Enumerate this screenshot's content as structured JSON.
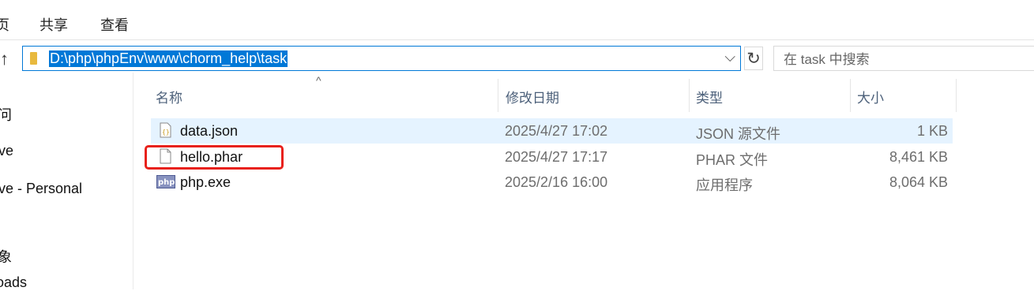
{
  "ribbon": {
    "tabs": [
      "页",
      "共享",
      "查看"
    ]
  },
  "address": {
    "path": "D:\\php\\phpEnv\\www\\chorm_help\\task"
  },
  "search": {
    "placeholder": "在 task 中搜索"
  },
  "nav": {
    "items": [
      "问",
      "ve",
      "ve - Personal",
      "象",
      "oads"
    ]
  },
  "columns": {
    "name": "名称",
    "date": "修改日期",
    "type": "类型",
    "size": "大小"
  },
  "files": [
    {
      "name": "data.json",
      "date": "2025/4/27 17:02",
      "type": "JSON 源文件",
      "size": "1 KB",
      "icon": "json-file-icon",
      "selected": true
    },
    {
      "name": "hello.phar",
      "date": "2025/4/27 17:17",
      "type": "PHAR 文件",
      "size": "8,461 KB",
      "icon": "blank-file-icon",
      "highlighted": true
    },
    {
      "name": "php.exe",
      "date": "2025/2/16 16:00",
      "type": "应用程序",
      "size": "8,064 KB",
      "icon": "php-exe-icon"
    }
  ],
  "icons": {
    "php_label": "php"
  },
  "colors": {
    "accent": "#0078d7",
    "selection": "#e5f3ff",
    "highlight_box": "#e8211b",
    "folder": "#e8b93e"
  }
}
